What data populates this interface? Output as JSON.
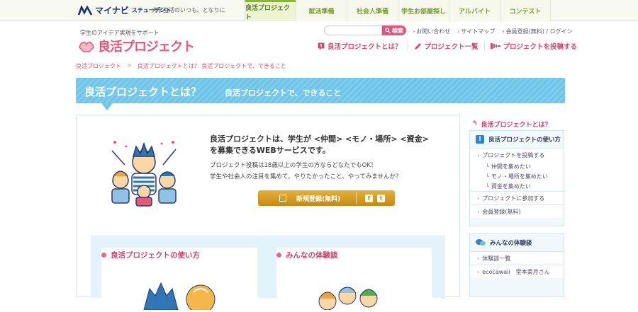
{
  "topbar": {
    "brand": "マイナビ",
    "brand_sub": "スチューデント",
    "tagline": "大学生活のいつも、となりに",
    "tabs": [
      {
        "label": "良活プロジェクト",
        "active": true
      },
      {
        "label": "就活準備",
        "active": false
      },
      {
        "label": "社会人準備",
        "active": false
      },
      {
        "label": "学生お部屋探し",
        "active": false
      },
      {
        "label": "アルバイト",
        "active": false
      },
      {
        "label": "コンテスト",
        "active": false
      }
    ]
  },
  "header": {
    "catch": "学生のアイデア実現をサポート",
    "site_title": "良活プロジェクト",
    "search": {
      "placeholder": "",
      "button": "検索"
    },
    "utility": [
      "お問い合わせ",
      "サイトマップ",
      "会員登録(無料) / ログイン"
    ],
    "subnav": [
      "良活プロジェクトとは？",
      "プロジェクト一覧",
      "プロジェクトを投稿する"
    ]
  },
  "breadcrumb": [
    "良活プロジェクト",
    ">",
    "良活プロジェクトとは？ 良活プロジェクトで、できること"
  ],
  "hero": {
    "title": "良活プロジェクトとは？",
    "subtitle": "良活プロジェクトで、できること"
  },
  "intro": {
    "line1": "良活プロジェクトは、学生が <仲間> <モノ・場所> <資金>",
    "line2": "を募集できるWEBサービスです。",
    "line3": "プロジェクト投稿は18歳以上の学生の方ならどなたでもOK！",
    "line4": "学生や社会人の注目を集めて、やりたかったこと、やってみませんか？",
    "register": "新規登録(無料)",
    "sns": [
      "f",
      "t"
    ]
  },
  "cards": [
    {
      "title": "良活プロジェクトの使い方"
    },
    {
      "title": "みんなの体験談"
    }
  ],
  "sidebar": {
    "head": "良活プロジェクトとは？",
    "section1": {
      "title": "良活プロジェクトの使い方",
      "rows": [
        {
          "label": "プロジェクトを投稿する",
          "subs": [
            "仲間を集めたい",
            "モノ・場所を集めたい",
            "資金を集めたい"
          ]
        },
        {
          "label": "プロジェクトに参加する",
          "subs": []
        },
        {
          "label": "会員登録(無料)",
          "subs": []
        }
      ]
    },
    "section2": {
      "title": "みんなの体験談",
      "rows": [
        "体験談一覧",
        "ecocawaii　堂本菜月さん"
      ]
    }
  },
  "colors": {
    "accent": "#e1557c",
    "hero": "#74c8e9",
    "gnav": "#8cb43c",
    "button": "#d19a21"
  }
}
